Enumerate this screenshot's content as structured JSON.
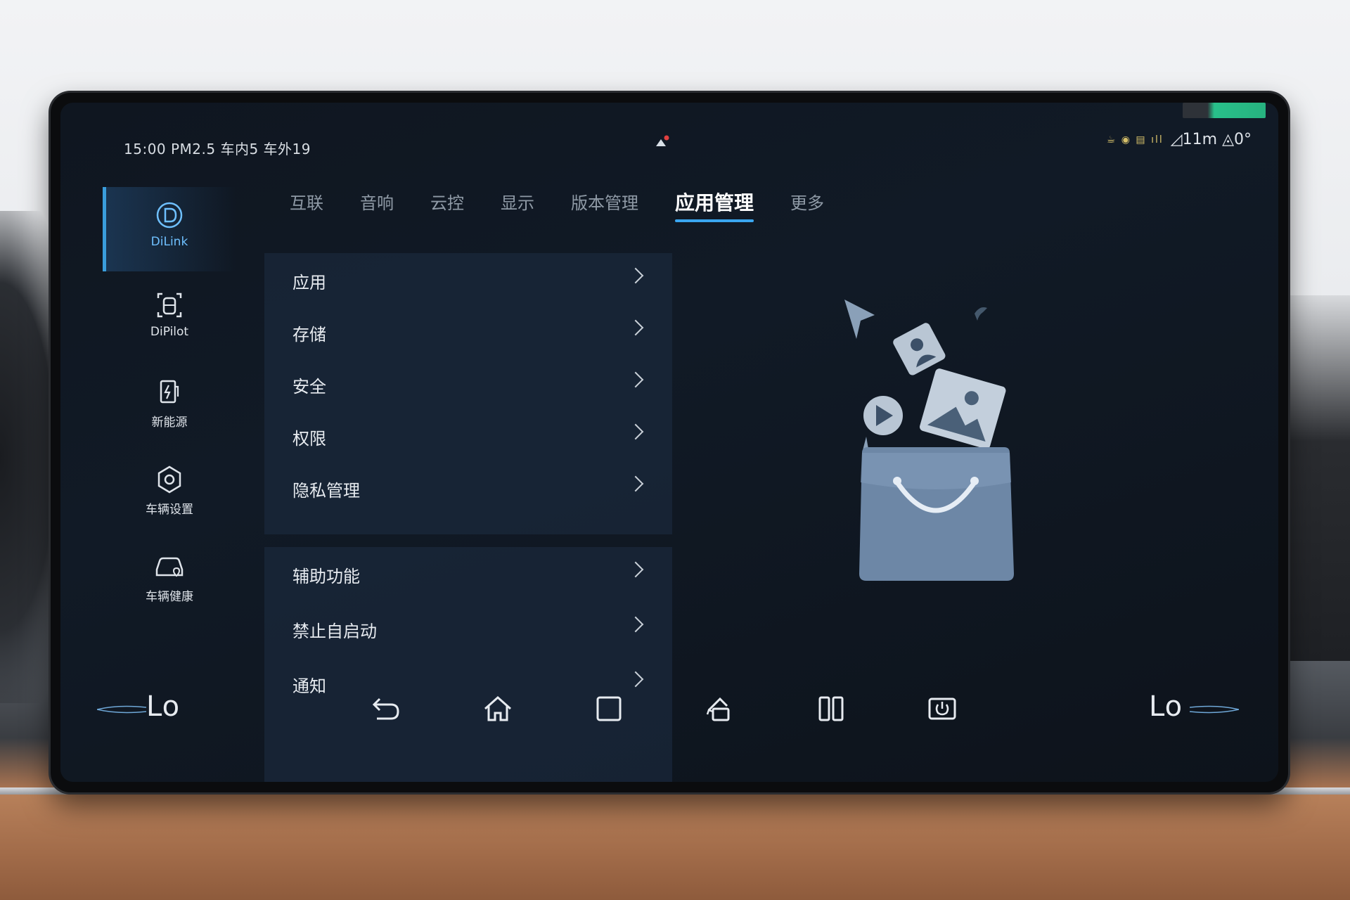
{
  "status_bar": {
    "left_text": "15:00 PM2.5 车内5 车外19",
    "right_text": "◿11m ◬0°"
  },
  "sidebar": {
    "items": [
      {
        "label": "DiLink",
        "icon": "dilink-icon",
        "active": true
      },
      {
        "label": "DiPilot",
        "icon": "dipilot-icon",
        "active": false
      },
      {
        "label": "新能源",
        "icon": "new-energy-icon",
        "active": false
      },
      {
        "label": "车辆设置",
        "icon": "vehicle-settings-icon",
        "active": false
      },
      {
        "label": "车辆健康",
        "icon": "vehicle-health-icon",
        "active": false
      }
    ]
  },
  "tabs": [
    {
      "label": "互联",
      "active": false
    },
    {
      "label": "音响",
      "active": false
    },
    {
      "label": "云控",
      "active": false
    },
    {
      "label": "显示",
      "active": false
    },
    {
      "label": "版本管理",
      "active": false
    },
    {
      "label": "应用管理",
      "active": true
    },
    {
      "label": "更多",
      "active": false
    }
  ],
  "menu_group_1": [
    "应用",
    "存储",
    "安全",
    "权限",
    "隐私管理"
  ],
  "menu_group_2": [
    "辅助功能",
    "禁止自启动",
    "通知"
  ],
  "nav": {
    "left_temp": "Lo",
    "right_temp": "Lo",
    "buttons": [
      "back-icon",
      "home-icon",
      "recent-apps-icon",
      "rotate-screen-icon",
      "split-screen-icon",
      "screen-off-icon"
    ]
  },
  "colors": {
    "accent": "#3aa6f0",
    "screen_bg": "#111a26",
    "panel_bg": "#1a283c"
  }
}
